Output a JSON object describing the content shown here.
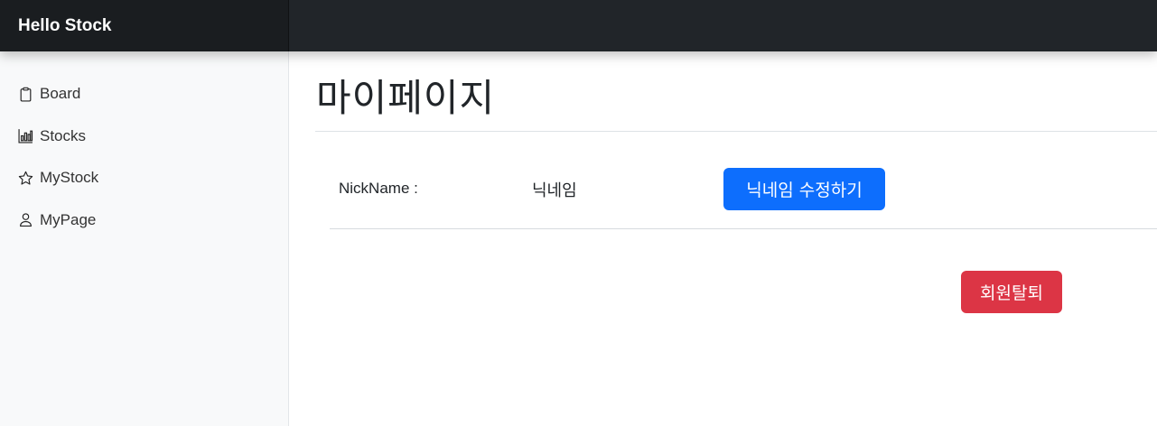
{
  "navbar": {
    "brand": "Hello Stock"
  },
  "sidebar": {
    "items": [
      {
        "label": "Board",
        "icon": "clipboard-icon"
      },
      {
        "label": "Stocks",
        "icon": "bar-chart-icon"
      },
      {
        "label": "MyStock",
        "icon": "star-icon"
      },
      {
        "label": "MyPage",
        "icon": "person-icon"
      }
    ]
  },
  "main": {
    "title": "마이페이지",
    "nickname_label": "NickName :",
    "nickname_value": "닉네임",
    "edit_button": "닉네임 수정하기",
    "withdraw_button": "회원탈퇴"
  },
  "colors": {
    "navbar": "#212529",
    "sidebar": "#f8f9fa",
    "primary": "#0d6efd",
    "danger": "#dc3545"
  }
}
